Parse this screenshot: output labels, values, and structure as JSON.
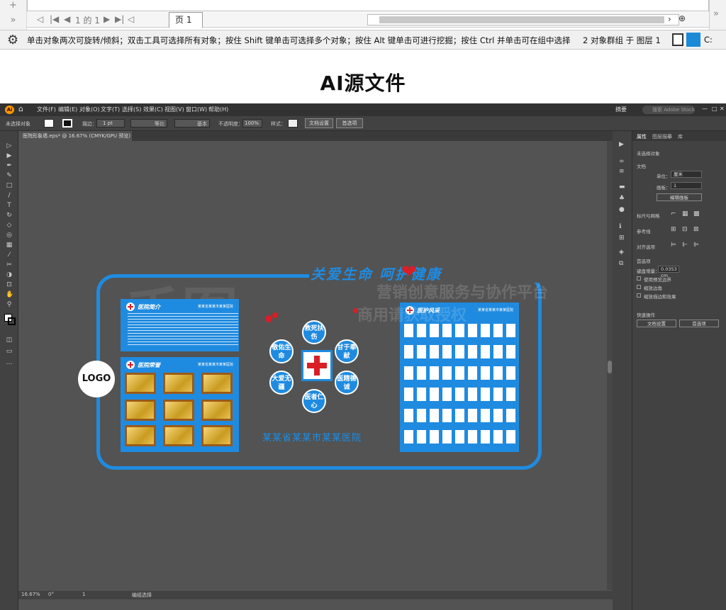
{
  "top_window": {
    "left_glyphs": [
      "+",
      "»"
    ],
    "nav": [
      "◁",
      "|◀",
      "◀",
      "1 的 1",
      "▶",
      "▶|",
      "◁"
    ],
    "tab_label": "页 1",
    "scroll_right": "›",
    "zoom_icon": "⊕",
    "right_glyph": "»"
  },
  "statusbar": {
    "message": "单击对象两次可旋转/倾斜；双击工具可选择所有对象；按住 Shift 键单击可选择多个对象；按住 Alt 键单击可进行挖掘；按住 Ctrl 并单击可在组中选择",
    "group_info": "2 对象群组 于 图层 1",
    "fill_color": "#1b8ad8",
    "c_label": "C:"
  },
  "heading": "AI源文件",
  "ai": {
    "menu": [
      "文件(F)",
      "编辑(E)",
      "对象(O)",
      "文字(T)",
      "选择(S)",
      "效果(C)",
      "视图(V)",
      "窗口(W)",
      "帮助(H)"
    ],
    "logo": "Ai",
    "menu_right": "摘要",
    "search_placeholder": "搜索 Adobe Stock",
    "ctrl": {
      "no_selection": "未选择对象",
      "stroke_label": "描边：",
      "stroke_value": "1 pt",
      "uniform": "等比",
      "basic": "基本",
      "opacity_label": "不透明度：",
      "opacity_value": "100%",
      "style_label": "样式：",
      "doc_setup": "文档设置",
      "prefs": "首选项"
    },
    "doc_tab": "医院形象墙.eps* @ 16.67% (CMYK/GPU 预览)",
    "status": {
      "zoom": "16.67%",
      "rotation": "0°",
      "page": "1",
      "tool": "编组选择"
    },
    "props": {
      "tabs": [
        "属性",
        "图层描摹",
        "库"
      ],
      "no_selection": "未选择对象",
      "document": "文档",
      "unit_label": "单位：",
      "unit_value": "厘米",
      "artboard_label": "画板：",
      "artboard_value": "1",
      "edit_artboard": "编辑画板",
      "rulers": "标尺与网格",
      "guides": "参考线",
      "align": "对齐选项",
      "prefs_title": "首选项",
      "key_incr_label": "键盘增量：",
      "key_incr_value": "0.0353 cm",
      "chk1": "使用预览边界",
      "chk2": "缩放边角",
      "chk3": "缩放描边和效果",
      "quick": "快速操作",
      "doc_setup": "文档设置",
      "prefs": "首选项"
    },
    "art": {
      "slogan": "关爱生命    呵护健康",
      "logo": "LOGO",
      "panel1_title": "医院简介",
      "panel1_sub": "某某省某某市某某医院",
      "panel2_title": "医院荣誉",
      "panel2_sub": "某某省某某市某某医院",
      "panel3_title": "医护风采",
      "panel3_sub": "某某省某某市某某医院",
      "hex": [
        "救死扶伤",
        "甘于奉献",
        "医精德诚",
        "医者仁心",
        "大爱无疆",
        "敬佑生命"
      ],
      "hospital": "某某省某某市某某医院",
      "watermark1": "营销创意服务与协作平台",
      "watermark2": "商用请获取授权",
      "watermark_logo": "千图"
    }
  }
}
